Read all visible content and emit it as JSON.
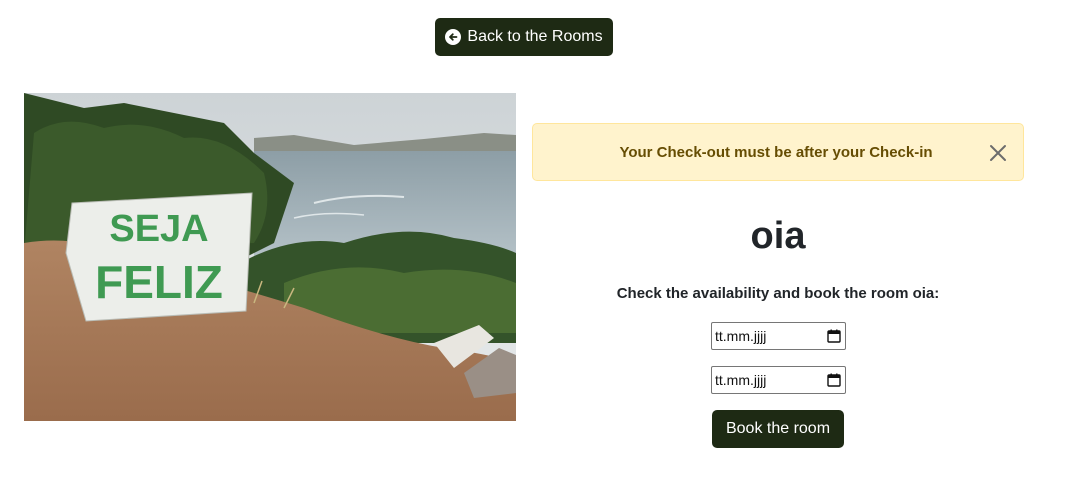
{
  "nav": {
    "back_label": "Back to the Rooms",
    "back_icon": "arrow-left-circle-icon"
  },
  "photo": {
    "sign_text_line1": "SEJA",
    "sign_text_line2": "FELIZ"
  },
  "alert": {
    "message": "Your Check-out must be after your Check-in",
    "close_icon": "close-icon"
  },
  "room": {
    "title": "oia",
    "subtitle": "Check the availability and book the room oia:"
  },
  "form": {
    "checkin_placeholder": "tt.mm.jjjj",
    "checkout_placeholder": "tt.mm.jjjj",
    "calendar_icon": "calendar-icon",
    "book_label": "Book the room"
  },
  "colors": {
    "primary_button": "#1e2a14",
    "alert_background": "#fff3cd",
    "alert_text": "#664d03"
  }
}
